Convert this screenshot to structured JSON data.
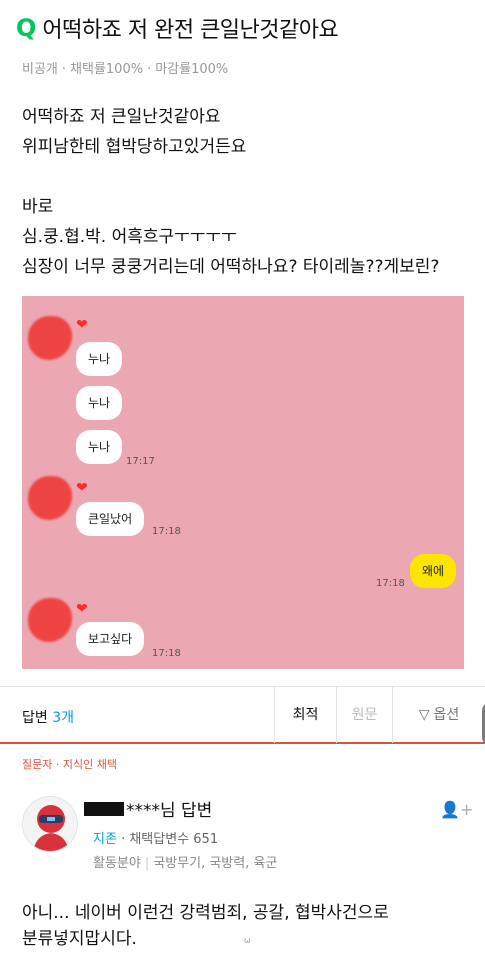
{
  "question": {
    "badge": "Q",
    "title": "어떡하죠 저 완전 큰일난것같아요",
    "meta": [
      "비공개",
      "채택률100%",
      "마감률100%"
    ],
    "meta_sep": "·",
    "body": [
      "어떡하죠 저 큰일난것같아요",
      "위피남한테 협박당하고있거든요",
      "",
      "바로",
      "심.쿵.협.박. 어흑흐구ㅜㅜㅜㅜ",
      "심장이 너무 쿵쿵거리는데 어떡하나요? 타이레놀??게보린?"
    ]
  },
  "chat": {
    "heart": "❤",
    "messages": [
      {
        "text": "누나",
        "from": "other"
      },
      {
        "text": "누나",
        "from": "other"
      },
      {
        "text": "누나",
        "from": "other",
        "time": "17:17"
      },
      {
        "text": "큰일났어",
        "from": "other",
        "time": "17:18"
      },
      {
        "text": "왜에",
        "from": "me",
        "time": "17:18"
      },
      {
        "text": "보고싶다",
        "from": "other",
        "time": "17:18"
      }
    ]
  },
  "answers_bar": {
    "label": "답변",
    "count": "3개",
    "sort_options": [
      "최적",
      "원문",
      "옵션"
    ]
  },
  "answer": {
    "adopt_label": "질문자 · 지식인 채택",
    "author_masked": "****님 답변",
    "grade": "지존",
    "adopt_count_label": "채택답변수 651",
    "field_label": "활동분야",
    "fields": "국방무기, 국방력, 육군",
    "body": [
      "아니... 네이버 이런건 강력범죄, 공갈, 협박사건으로",
      "분류넣지맙시다."
    ],
    "tiny_mark": "ω"
  },
  "colors": {
    "accent_green": "#03c75a",
    "chat_background": "#eba8b2",
    "my_bubble": "#fee500",
    "count_blue": "#03a0e0",
    "adopt_red": "#e0513f"
  }
}
